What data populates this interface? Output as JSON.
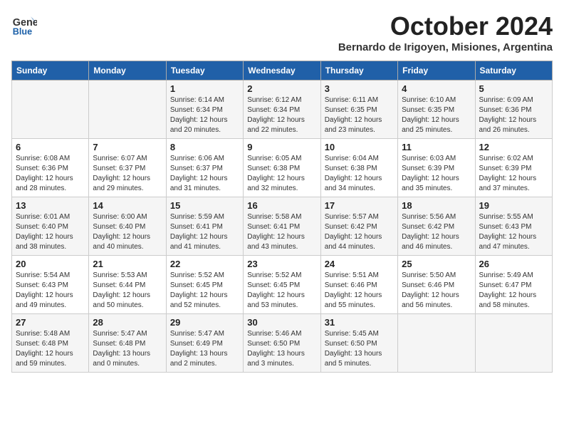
{
  "header": {
    "logo_line1": "General",
    "logo_line2": "Blue",
    "month_title": "October 2024",
    "subtitle": "Bernardo de Irigoyen, Misiones, Argentina"
  },
  "days_of_week": [
    "Sunday",
    "Monday",
    "Tuesday",
    "Wednesday",
    "Thursday",
    "Friday",
    "Saturday"
  ],
  "weeks": [
    [
      {
        "day": "",
        "sunrise": "",
        "sunset": "",
        "daylight": ""
      },
      {
        "day": "",
        "sunrise": "",
        "sunset": "",
        "daylight": ""
      },
      {
        "day": "1",
        "sunrise": "Sunrise: 6:14 AM",
        "sunset": "Sunset: 6:34 PM",
        "daylight": "Daylight: 12 hours and 20 minutes."
      },
      {
        "day": "2",
        "sunrise": "Sunrise: 6:12 AM",
        "sunset": "Sunset: 6:34 PM",
        "daylight": "Daylight: 12 hours and 22 minutes."
      },
      {
        "day": "3",
        "sunrise": "Sunrise: 6:11 AM",
        "sunset": "Sunset: 6:35 PM",
        "daylight": "Daylight: 12 hours and 23 minutes."
      },
      {
        "day": "4",
        "sunrise": "Sunrise: 6:10 AM",
        "sunset": "Sunset: 6:35 PM",
        "daylight": "Daylight: 12 hours and 25 minutes."
      },
      {
        "day": "5",
        "sunrise": "Sunrise: 6:09 AM",
        "sunset": "Sunset: 6:36 PM",
        "daylight": "Daylight: 12 hours and 26 minutes."
      }
    ],
    [
      {
        "day": "6",
        "sunrise": "Sunrise: 6:08 AM",
        "sunset": "Sunset: 6:36 PM",
        "daylight": "Daylight: 12 hours and 28 minutes."
      },
      {
        "day": "7",
        "sunrise": "Sunrise: 6:07 AM",
        "sunset": "Sunset: 6:37 PM",
        "daylight": "Daylight: 12 hours and 29 minutes."
      },
      {
        "day": "8",
        "sunrise": "Sunrise: 6:06 AM",
        "sunset": "Sunset: 6:37 PM",
        "daylight": "Daylight: 12 hours and 31 minutes."
      },
      {
        "day": "9",
        "sunrise": "Sunrise: 6:05 AM",
        "sunset": "Sunset: 6:38 PM",
        "daylight": "Daylight: 12 hours and 32 minutes."
      },
      {
        "day": "10",
        "sunrise": "Sunrise: 6:04 AM",
        "sunset": "Sunset: 6:38 PM",
        "daylight": "Daylight: 12 hours and 34 minutes."
      },
      {
        "day": "11",
        "sunrise": "Sunrise: 6:03 AM",
        "sunset": "Sunset: 6:39 PM",
        "daylight": "Daylight: 12 hours and 35 minutes."
      },
      {
        "day": "12",
        "sunrise": "Sunrise: 6:02 AM",
        "sunset": "Sunset: 6:39 PM",
        "daylight": "Daylight: 12 hours and 37 minutes."
      }
    ],
    [
      {
        "day": "13",
        "sunrise": "Sunrise: 6:01 AM",
        "sunset": "Sunset: 6:40 PM",
        "daylight": "Daylight: 12 hours and 38 minutes."
      },
      {
        "day": "14",
        "sunrise": "Sunrise: 6:00 AM",
        "sunset": "Sunset: 6:40 PM",
        "daylight": "Daylight: 12 hours and 40 minutes."
      },
      {
        "day": "15",
        "sunrise": "Sunrise: 5:59 AM",
        "sunset": "Sunset: 6:41 PM",
        "daylight": "Daylight: 12 hours and 41 minutes."
      },
      {
        "day": "16",
        "sunrise": "Sunrise: 5:58 AM",
        "sunset": "Sunset: 6:41 PM",
        "daylight": "Daylight: 12 hours and 43 minutes."
      },
      {
        "day": "17",
        "sunrise": "Sunrise: 5:57 AM",
        "sunset": "Sunset: 6:42 PM",
        "daylight": "Daylight: 12 hours and 44 minutes."
      },
      {
        "day": "18",
        "sunrise": "Sunrise: 5:56 AM",
        "sunset": "Sunset: 6:42 PM",
        "daylight": "Daylight: 12 hours and 46 minutes."
      },
      {
        "day": "19",
        "sunrise": "Sunrise: 5:55 AM",
        "sunset": "Sunset: 6:43 PM",
        "daylight": "Daylight: 12 hours and 47 minutes."
      }
    ],
    [
      {
        "day": "20",
        "sunrise": "Sunrise: 5:54 AM",
        "sunset": "Sunset: 6:43 PM",
        "daylight": "Daylight: 12 hours and 49 minutes."
      },
      {
        "day": "21",
        "sunrise": "Sunrise: 5:53 AM",
        "sunset": "Sunset: 6:44 PM",
        "daylight": "Daylight: 12 hours and 50 minutes."
      },
      {
        "day": "22",
        "sunrise": "Sunrise: 5:52 AM",
        "sunset": "Sunset: 6:45 PM",
        "daylight": "Daylight: 12 hours and 52 minutes."
      },
      {
        "day": "23",
        "sunrise": "Sunrise: 5:52 AM",
        "sunset": "Sunset: 6:45 PM",
        "daylight": "Daylight: 12 hours and 53 minutes."
      },
      {
        "day": "24",
        "sunrise": "Sunrise: 5:51 AM",
        "sunset": "Sunset: 6:46 PM",
        "daylight": "Daylight: 12 hours and 55 minutes."
      },
      {
        "day": "25",
        "sunrise": "Sunrise: 5:50 AM",
        "sunset": "Sunset: 6:46 PM",
        "daylight": "Daylight: 12 hours and 56 minutes."
      },
      {
        "day": "26",
        "sunrise": "Sunrise: 5:49 AM",
        "sunset": "Sunset: 6:47 PM",
        "daylight": "Daylight: 12 hours and 58 minutes."
      }
    ],
    [
      {
        "day": "27",
        "sunrise": "Sunrise: 5:48 AM",
        "sunset": "Sunset: 6:48 PM",
        "daylight": "Daylight: 12 hours and 59 minutes."
      },
      {
        "day": "28",
        "sunrise": "Sunrise: 5:47 AM",
        "sunset": "Sunset: 6:48 PM",
        "daylight": "Daylight: 13 hours and 0 minutes."
      },
      {
        "day": "29",
        "sunrise": "Sunrise: 5:47 AM",
        "sunset": "Sunset: 6:49 PM",
        "daylight": "Daylight: 13 hours and 2 minutes."
      },
      {
        "day": "30",
        "sunrise": "Sunrise: 5:46 AM",
        "sunset": "Sunset: 6:50 PM",
        "daylight": "Daylight: 13 hours and 3 minutes."
      },
      {
        "day": "31",
        "sunrise": "Sunrise: 5:45 AM",
        "sunset": "Sunset: 6:50 PM",
        "daylight": "Daylight: 13 hours and 5 minutes."
      },
      {
        "day": "",
        "sunrise": "",
        "sunset": "",
        "daylight": ""
      },
      {
        "day": "",
        "sunrise": "",
        "sunset": "",
        "daylight": ""
      }
    ]
  ]
}
